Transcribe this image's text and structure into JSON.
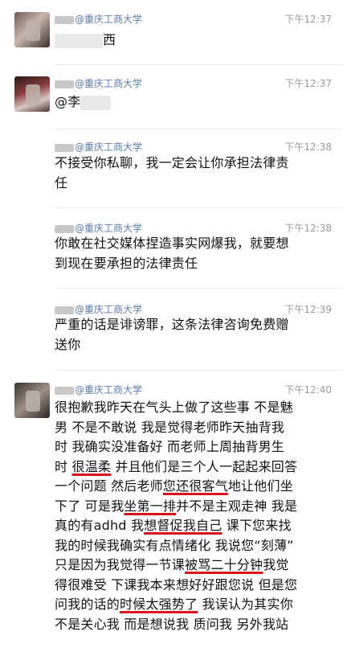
{
  "messages": [
    {
      "sender": "@重庆工商大学",
      "time": "下午12:37",
      "text": "西"
    },
    {
      "sender": "@重庆工商大学",
      "time": "下午12:37",
      "text": "@李"
    },
    {
      "sender": "@重庆工商大学",
      "time": "下午12:38",
      "lines": [
        "不接受你私聊，我一定会让你承担法律责",
        "任"
      ]
    },
    {
      "sender": "@重庆工商大学",
      "time": "下午12:38",
      "lines": [
        "你敢在社交媒体捏造事实网爆我，就要想",
        "到现在要承担的法律责任"
      ]
    },
    {
      "sender": "@重庆工商大学",
      "time": "下午12:39",
      "lines": [
        "严重的话是诽谤罪，这条法律咨询免费赠",
        "送你"
      ]
    },
    {
      "sender": "@重庆工商大学",
      "time": "下午12:40",
      "lines": [
        "很抱歉我昨天在气头上做了这些事 不是魅",
        "男 不是不敢说 我是觉得老师昨天抽背我",
        "时 我确实没准备好 而老师上周抽背男生",
        "时 很温柔 并且他们是三个人一起起来回答",
        "一个问题 然后老师您还很客气地让他们坐",
        "下了 可是我坐第一排并不是主观走神 我是",
        "真的有adhd 我想督促我自己 课下您来找",
        "我的时候我确实有点情绪化 我说您“刻薄”",
        "只是因为我觉得一节课被骂二十分钟我觉",
        "得很难受 下课我本来想好好跟您说 但是您",
        "问我的话的时候太强势了 我误认为其实你",
        "不是关心我 而是想说我 质问我 另外我站"
      ]
    }
  ]
}
